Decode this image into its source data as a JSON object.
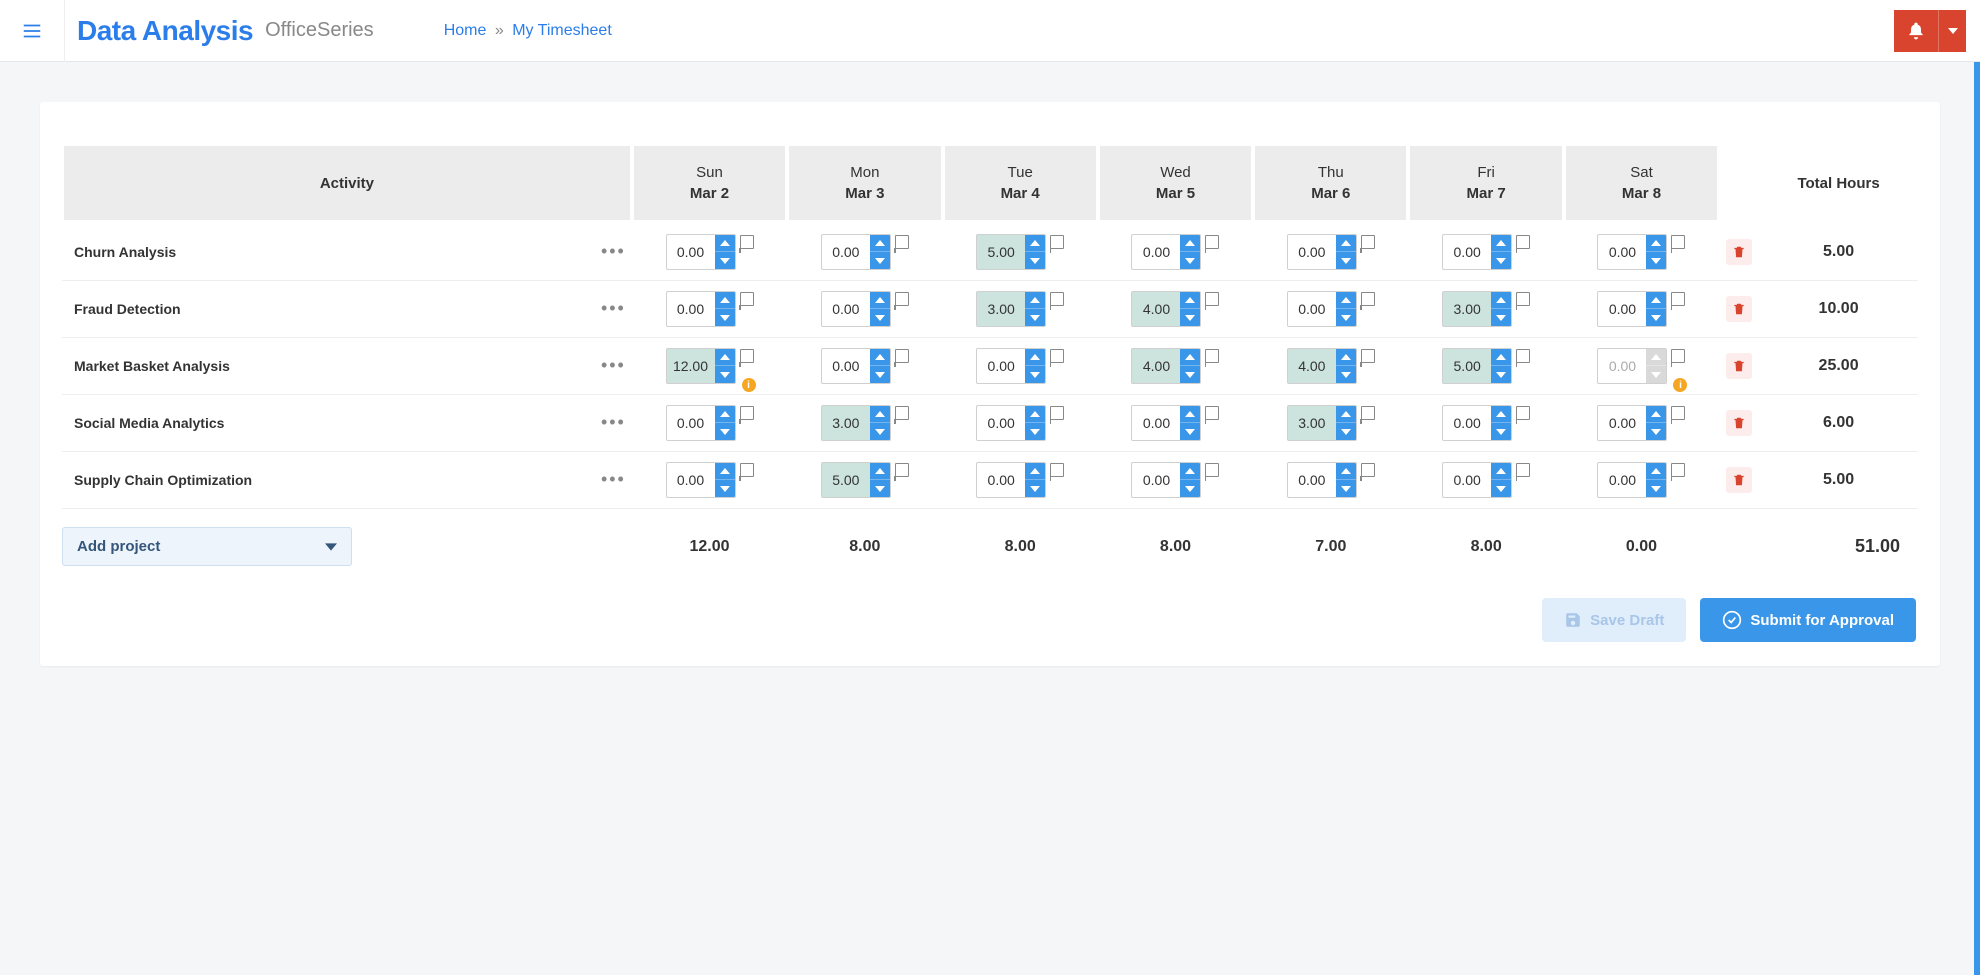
{
  "header": {
    "brand": "Data Analysis",
    "sub_brand": "OfficeSeries",
    "breadcrumb_home": "Home",
    "breadcrumb_current": "My Timesheet"
  },
  "columns": {
    "activity": "Activity",
    "total": "Total Hours",
    "days": [
      {
        "dow": "Sun",
        "date": "Mar 2"
      },
      {
        "dow": "Mon",
        "date": "Mar 3"
      },
      {
        "dow": "Tue",
        "date": "Mar 4"
      },
      {
        "dow": "Wed",
        "date": "Mar 5"
      },
      {
        "dow": "Thu",
        "date": "Mar 6"
      },
      {
        "dow": "Fri",
        "date": "Mar 7"
      },
      {
        "dow": "Sat",
        "date": "Mar 8"
      }
    ]
  },
  "rows": [
    {
      "name": "Churn Analysis",
      "cells": [
        {
          "v": "0.00",
          "filled": false
        },
        {
          "v": "0.00",
          "filled": false
        },
        {
          "v": "5.00",
          "filled": true
        },
        {
          "v": "0.00",
          "filled": false
        },
        {
          "v": "0.00",
          "filled": false
        },
        {
          "v": "0.00",
          "filled": false
        },
        {
          "v": "0.00",
          "filled": false
        }
      ],
      "total": "5.00"
    },
    {
      "name": "Fraud Detection",
      "cells": [
        {
          "v": "0.00",
          "filled": false
        },
        {
          "v": "0.00",
          "filled": false
        },
        {
          "v": "3.00",
          "filled": true
        },
        {
          "v": "4.00",
          "filled": true
        },
        {
          "v": "0.00",
          "filled": false
        },
        {
          "v": "3.00",
          "filled": true
        },
        {
          "v": "0.00",
          "filled": false
        }
      ],
      "total": "10.00"
    },
    {
      "name": "Market Basket Analysis",
      "cells": [
        {
          "v": "12.00",
          "filled": true,
          "warn": true
        },
        {
          "v": "0.00",
          "filled": false
        },
        {
          "v": "0.00",
          "filled": false
        },
        {
          "v": "4.00",
          "filled": true
        },
        {
          "v": "4.00",
          "filled": true
        },
        {
          "v": "5.00",
          "filled": true
        },
        {
          "v": "0.00",
          "filled": false,
          "disabled": true,
          "warn": true
        }
      ],
      "total": "25.00"
    },
    {
      "name": "Social Media Analytics",
      "cells": [
        {
          "v": "0.00",
          "filled": false
        },
        {
          "v": "3.00",
          "filled": true
        },
        {
          "v": "0.00",
          "filled": false
        },
        {
          "v": "0.00",
          "filled": false
        },
        {
          "v": "3.00",
          "filled": true
        },
        {
          "v": "0.00",
          "filled": false
        },
        {
          "v": "0.00",
          "filled": false
        }
      ],
      "total": "6.00"
    },
    {
      "name": "Supply Chain Optimization",
      "cells": [
        {
          "v": "0.00",
          "filled": false
        },
        {
          "v": "5.00",
          "filled": true
        },
        {
          "v": "0.00",
          "filled": false
        },
        {
          "v": "0.00",
          "filled": false
        },
        {
          "v": "0.00",
          "filled": false
        },
        {
          "v": "0.00",
          "filled": false
        },
        {
          "v": "0.00",
          "filled": false
        }
      ],
      "total": "5.00"
    }
  ],
  "footer": {
    "add_project": "Add project",
    "day_totals": [
      "12.00",
      "8.00",
      "8.00",
      "8.00",
      "7.00",
      "8.00",
      "0.00"
    ],
    "grand_total": "51.00"
  },
  "actions": {
    "save_draft": "Save Draft",
    "submit": "Submit for Approval"
  }
}
